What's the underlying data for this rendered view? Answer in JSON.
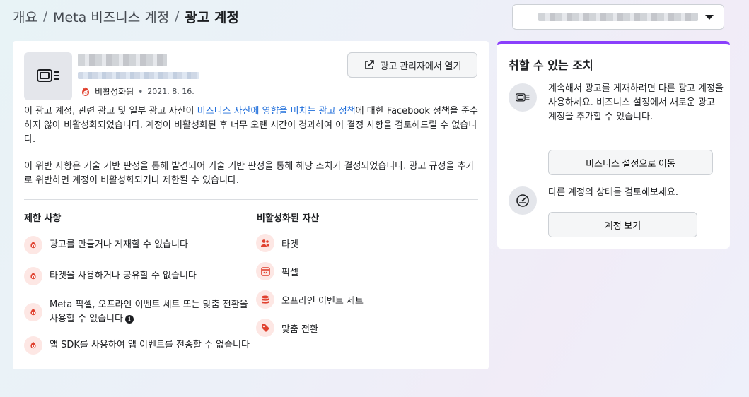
{
  "breadcrumb": {
    "items": [
      "개요",
      "Meta 비즈니스 계정"
    ],
    "current": "광고 계정",
    "separator": "/"
  },
  "account_selector": {
    "value_obscured": true
  },
  "account": {
    "status": "비활성화됨",
    "bullet": "•",
    "date": "2021. 8. 16.",
    "open_button": "광고 관리자에서 열기"
  },
  "description": {
    "p1_before_link": "이 광고 계정, 관련 광고 및 일부 광고 자산이 ",
    "p1_link": "비즈니스 자산에 영향을 미치는 광고 정책",
    "p1_after_link": "에 대한 Facebook 정책을 준수하지 않아 비활성화되었습니다. 계정이 비활성화된 후 너무 오랜 시간이 경과하여 이 결정 사항을 검토해드릴 수 없습니다.",
    "p2": "이 위반 사항은 기술 기반 판정을 통해 발견되어 기술 기반 판정을 통해 해당 조치가 결정되었습니다. 광고 규정을 추가로 위반하면 계정이 비활성화되거나 제한될 수 있습니다."
  },
  "restrictions": {
    "title": "제한 사항",
    "items": [
      "광고를 만들거나 게재할 수 없습니다",
      "타겟을 사용하거나 공유할 수 없습니다",
      "Meta 픽셀, 오프라인 이벤트 세트 또는 맞춤 전환을 사용할 수 없습니다",
      "앱 SDK를 사용하여 앱 이벤트를 전송할 수 없습니다"
    ]
  },
  "disabled_assets": {
    "title": "비활성화된 자산",
    "items": [
      {
        "label": "타겟",
        "icon": "people-icon"
      },
      {
        "label": "픽셀",
        "icon": "pixel-icon"
      },
      {
        "label": "오프라인 이벤트 세트",
        "icon": "database-icon"
      },
      {
        "label": "맞춤 전환",
        "icon": "tag-icon"
      }
    ]
  },
  "actions": {
    "title": "취할 수 있는 조치",
    "item1_text": "계속해서 광고를 게재하려면 다른 광고 계정을 사용하세요. 비즈니스 설정에서 새로운 광고 계정을 추가할 수 있습니다.",
    "item1_button": "비즈니스 설정으로 이동",
    "item2_text": "다른 계정의 상태를 검토해보세요.",
    "item2_button": "계정 보기"
  },
  "colors": {
    "accent_purple": "#8a3ffc",
    "link_blue": "#216fdb",
    "danger_red": "#e0412f",
    "danger_bg": "#fde7e4"
  }
}
